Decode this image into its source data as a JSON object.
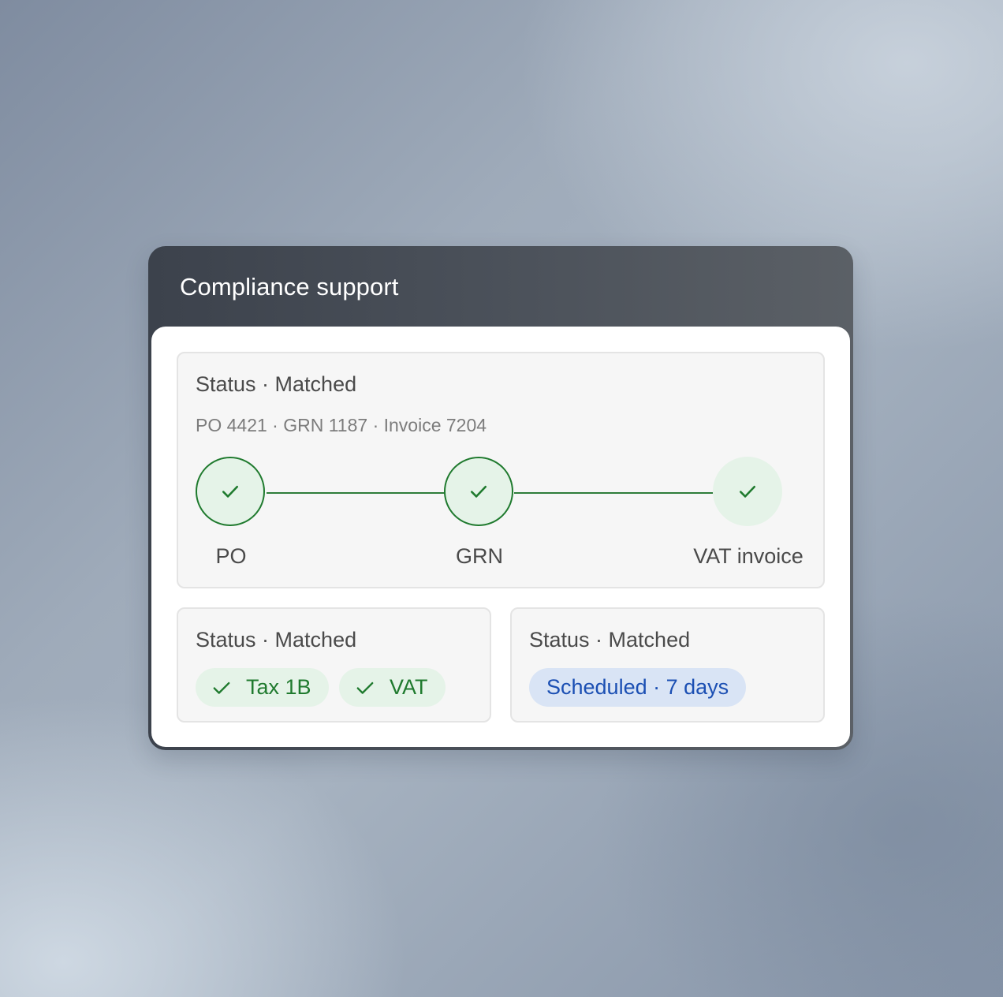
{
  "panel": {
    "title": "Compliance support"
  },
  "match_card": {
    "status": "Status · Matched",
    "reference": "PO 4421 · GRN 1187 · Invoice 7204",
    "steps": [
      {
        "label": "PO",
        "icon": "check-icon"
      },
      {
        "label": "GRN",
        "icon": "check-icon"
      },
      {
        "label": "VAT invoice",
        "icon": "check-icon"
      }
    ]
  },
  "tax_card": {
    "status": "Status · Matched",
    "chips": [
      {
        "label": "Tax 1B",
        "icon": "check-icon"
      },
      {
        "label": "VAT",
        "icon": "check-icon"
      }
    ]
  },
  "payment_card": {
    "status": "Status · Matched",
    "chip": "Scheduled · 7 days"
  },
  "colors": {
    "header_bg": "#444a53",
    "success": "#1f7a2e",
    "success_bg": "#e5f3e8",
    "info": "#1b4fb3",
    "info_bg": "#d9e4f5"
  }
}
